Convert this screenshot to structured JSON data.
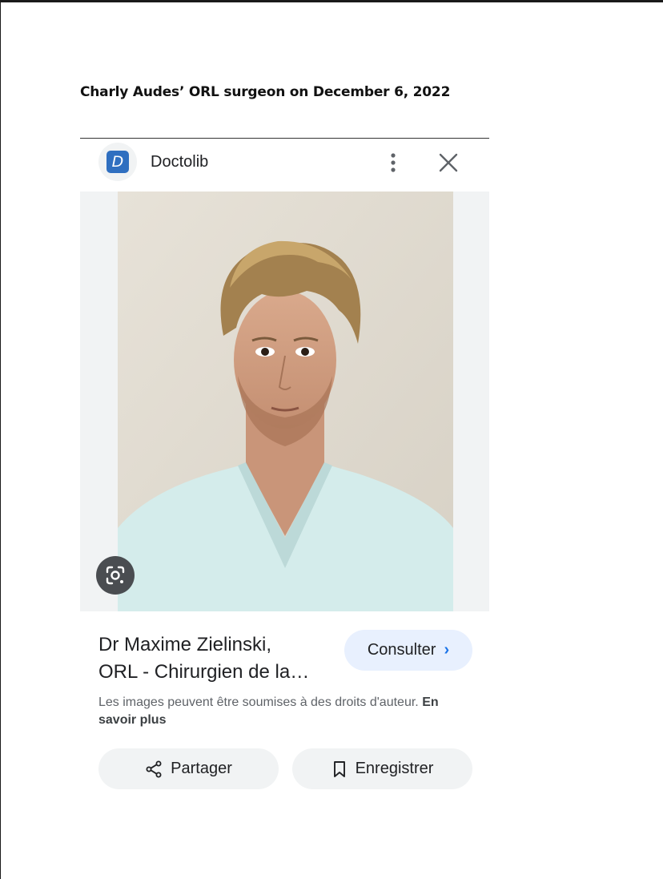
{
  "document": {
    "heading": "Charly Audes’ ORL surgeon on December 6, 2022"
  },
  "card": {
    "source": {
      "logo_letter": "D",
      "name": "Doctolib",
      "icons": [
        "more-vert-icon",
        "close-icon"
      ]
    },
    "image": {
      "subject": "portrait-photo",
      "lens_icon": "google-lens-icon"
    },
    "result": {
      "title_line1": "Dr Maxime Zielinski,",
      "title_line2": "ORL - Chirurgien de la…",
      "consult_label": "Consulter",
      "consult_chevron": "›"
    },
    "notice": {
      "text": "Les images peuvent être soumises à des droits d'auteur.",
      "link": "En savoir plus"
    },
    "actions": {
      "share_label": "Partager",
      "save_label": "Enregistrer"
    }
  },
  "colors": {
    "accent": "#1a73e8",
    "logo_bg": "#2f6fc0",
    "consult_bg": "#e8f0fe",
    "pill_bg": "#f1f3f4"
  }
}
